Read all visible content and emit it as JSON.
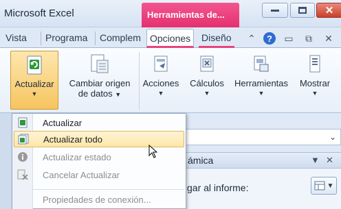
{
  "window": {
    "app_title": "Microsoft Excel",
    "context_tab": "Herramientas de..."
  },
  "tabs": [
    {
      "label": "Vista"
    },
    {
      "label": "Programa"
    },
    {
      "label": "Complem"
    },
    {
      "label": "Opciones"
    },
    {
      "label": "Diseño"
    }
  ],
  "ribbon": {
    "actualizar": "Actualizar",
    "cambiar_origen_1": "Cambiar origen",
    "cambiar_origen_2": "de datos",
    "acciones": "Acciones",
    "calculos": "Cálculos",
    "herramientas": "Herramientas",
    "mostrar": "Mostrar"
  },
  "menu": {
    "items": [
      {
        "label": "Actualizar",
        "icon": "refresh-icon",
        "state": "normal"
      },
      {
        "label": "Actualizar todo",
        "icon": "refresh-all-icon",
        "state": "hover"
      },
      {
        "label": "Actualizar estado",
        "icon": "info-icon",
        "state": "disabled"
      },
      {
        "label": "Cancelar Actualizar",
        "icon": "cancel-refresh-icon",
        "state": "disabled"
      },
      {
        "label": "Propiedades de conexión...",
        "icon": "",
        "state": "disabled"
      }
    ]
  },
  "pane": {
    "title_fragment": "ámica",
    "label_fragment": "gar al informe:"
  },
  "colors": {
    "context_accent": "#e4306f",
    "pressed": "#f7c460",
    "hover": "#fde7a8"
  }
}
